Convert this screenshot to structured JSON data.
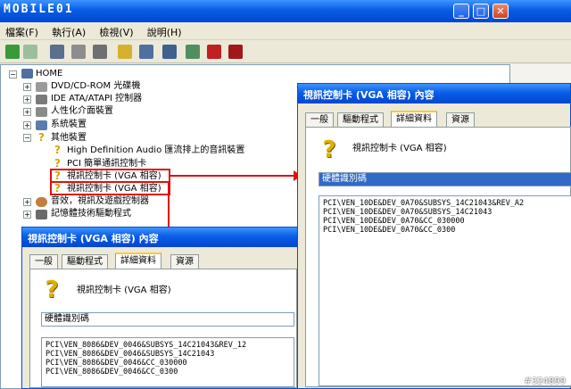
{
  "logo": "MOBILE01",
  "window_buttons": {
    "minimize": "_",
    "maximize": "□",
    "close": "✕"
  },
  "menu": [
    "檔案(F)",
    "執行(A)",
    "檢視(V)",
    "說明(H)"
  ],
  "tree": {
    "root": "HOME",
    "items": [
      "DVD/CD-ROM 光碟機",
      "IDE ATA/ATAPI 控制器",
      "人性化介面裝置",
      "系統裝置",
      "其他裝置",
      "High Definition Audio 匯流排上的音訊裝置",
      "PCI 簡單通訊控制卡",
      "視訊控制卡 (VGA 相容)",
      "視訊控制卡 (VGA 相容)",
      "音效，視訊及遊戲控制器",
      "記憶體技術驅動程式"
    ]
  },
  "dialog_left": {
    "title": "視訊控制卡 (VGA 相容) 內容",
    "tabs": [
      "一般",
      "驅動程式",
      "詳細資料",
      "資源"
    ],
    "device_name": "視訊控制卡 (VGA 相容)",
    "property": "硬體識別碼",
    "values": [
      "PCI\\VEN_8086&DEV_0046&SUBSYS_14C21043&REV_12",
      "PCI\\VEN_8086&DEV_0046&SUBSYS_14C21043",
      "PCI\\VEN_8086&DEV_0046&CC_030000",
      "PCI\\VEN_8086&DEV_0046&CC_0300"
    ]
  },
  "dialog_right": {
    "title": "視訊控制卡 (VGA 相容) 內容",
    "tabs": [
      "一般",
      "驅動程式",
      "詳細資料",
      "資源"
    ],
    "device_name": "視訊控制卡 (VGA 相容)",
    "property": "硬體識別碼",
    "values": [
      "PCI\\VEN_10DE&DEV_0A70&SUBSYS_14C21043&REV_A2",
      "PCI\\VEN_10DE&DEV_0A70&SUBSYS_14C21043",
      "PCI\\VEN_10DE&DEV_0A70&CC_030000",
      "PCI\\VEN_10DE&DEV_0A70&CC_0300"
    ]
  },
  "watermark": "#324899",
  "colors": {
    "accent": "#e01010",
    "titlebar": "#0a5de6",
    "selection": "#316ac5"
  }
}
